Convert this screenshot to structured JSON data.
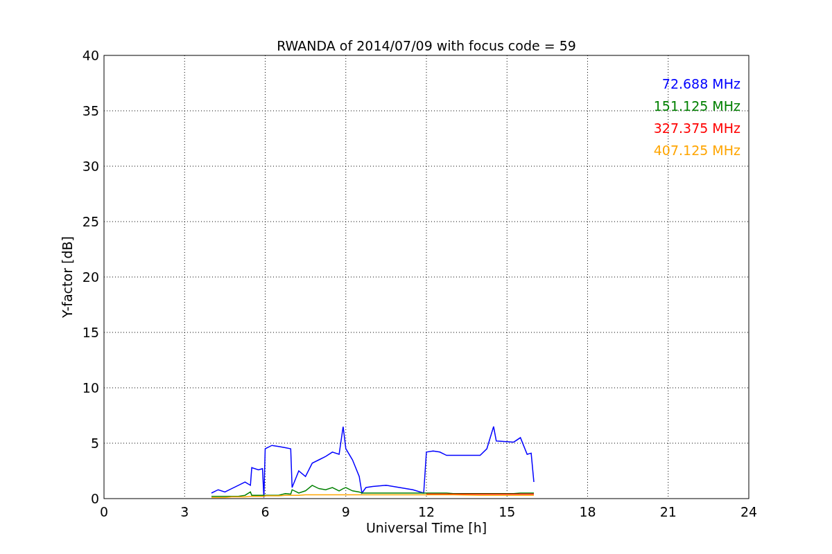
{
  "figure": {
    "chart_data": {
      "type": "line",
      "title": "RWANDA of 2014/07/09 with focus code = 59",
      "xlabel": "Universal Time [h]",
      "ylabel": "Y-factor [dB]",
      "xlim": [
        0,
        24
      ],
      "ylim": [
        0,
        40
      ],
      "xticks": [
        0,
        3,
        6,
        9,
        12,
        15,
        18,
        21,
        24
      ],
      "yticks": [
        0,
        5,
        10,
        15,
        20,
        25,
        30,
        35,
        40
      ],
      "grid": true,
      "x": [
        4.0,
        4.25,
        4.5,
        4.75,
        5.0,
        5.25,
        5.45,
        5.5,
        5.75,
        5.9,
        5.95,
        6.0,
        6.25,
        6.5,
        6.75,
        6.95,
        7.0,
        7.25,
        7.5,
        7.75,
        8.0,
        8.25,
        8.5,
        8.75,
        8.9,
        9.0,
        9.25,
        9.5,
        9.6,
        9.75,
        10.0,
        10.5,
        11.0,
        11.5,
        11.9,
        12.0,
        12.25,
        12.5,
        12.75,
        13.0,
        14.0,
        14.25,
        14.5,
        14.6,
        15.25,
        15.5,
        15.75,
        15.9,
        16.0
      ],
      "series": [
        {
          "name": "72.688 MHz",
          "color": "#0000ff",
          "values": [
            0.5,
            0.8,
            0.6,
            0.9,
            1.2,
            1.5,
            1.2,
            2.8,
            2.6,
            2.7,
            0.1,
            4.5,
            4.8,
            4.7,
            4.6,
            4.5,
            1.0,
            2.5,
            2.0,
            3.2,
            3.5,
            3.8,
            4.2,
            4.0,
            6.5,
            4.5,
            3.5,
            2.0,
            0.5,
            1.0,
            1.1,
            1.2,
            1.0,
            0.8,
            0.5,
            4.2,
            4.3,
            4.2,
            3.9,
            3.9,
            3.9,
            4.5,
            6.5,
            5.2,
            5.1,
            5.5,
            4.0,
            4.1,
            1.5
          ]
        },
        {
          "name": "151.125 MHz",
          "color": "#008000",
          "values": [
            0.2,
            0.2,
            0.2,
            0.2,
            0.2,
            0.3,
            0.6,
            0.3,
            0.3,
            0.3,
            0.3,
            0.3,
            0.3,
            0.3,
            0.45,
            0.4,
            0.8,
            0.5,
            0.7,
            1.2,
            0.9,
            0.8,
            1.0,
            0.7,
            0.9,
            1.0,
            0.7,
            0.6,
            0.5,
            0.5,
            0.5,
            0.5,
            0.5,
            0.5,
            0.5,
            0.5,
            0.5,
            0.5,
            0.5,
            0.45,
            0.45,
            0.45,
            0.45,
            0.45,
            0.45,
            0.5,
            0.5,
            0.5,
            0.5
          ]
        },
        {
          "name": "327.375 MHz",
          "color": "#ff0000",
          "values": [
            null,
            null,
            null,
            null,
            null,
            null,
            null,
            null,
            null,
            null,
            null,
            null,
            null,
            null,
            null,
            null,
            null,
            null,
            null,
            null,
            null,
            null,
            null,
            null,
            null,
            null,
            null,
            null,
            null,
            null,
            null,
            null,
            null,
            null,
            null,
            0.4,
            0.4,
            0.4,
            0.4,
            0.4,
            0.4,
            0.4,
            0.4,
            0.4,
            0.4,
            0.4,
            0.4,
            0.4,
            0.4
          ]
        },
        {
          "name": "407.125 MHz",
          "color": "#ffa500",
          "values": [
            0.1,
            0.1,
            0.1,
            0.15,
            0.15,
            0.15,
            0.2,
            0.2,
            0.2,
            0.2,
            0.2,
            0.25,
            0.25,
            0.25,
            0.3,
            0.3,
            0.3,
            0.3,
            0.35,
            0.35,
            0.35,
            0.35,
            0.35,
            0.35,
            0.35,
            0.35,
            0.35,
            0.35,
            0.35,
            0.35,
            0.35,
            0.35,
            0.35,
            0.35,
            0.35,
            0.35,
            0.35,
            0.35,
            0.35,
            0.35,
            0.3,
            0.3,
            0.3,
            0.3,
            0.3,
            0.3,
            0.3,
            0.3,
            0.3
          ]
        }
      ]
    }
  }
}
